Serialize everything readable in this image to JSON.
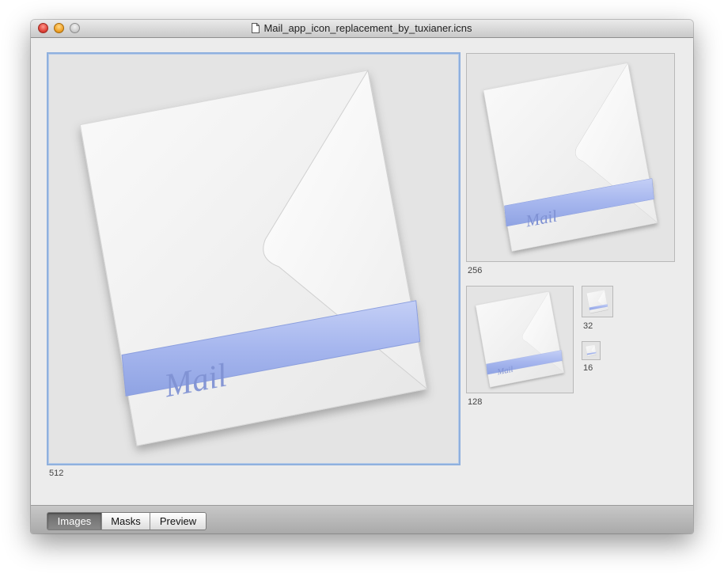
{
  "window": {
    "title": "Mail_app_icon_replacement_by_tuxianer.icns"
  },
  "icon": {
    "band_text": "Mail"
  },
  "sizes": [
    {
      "label": "512"
    },
    {
      "label": "256"
    },
    {
      "label": "128"
    },
    {
      "label": "32"
    },
    {
      "label": "16"
    }
  ],
  "tabs": [
    {
      "label": "Images",
      "selected": true
    },
    {
      "label": "Masks",
      "selected": false
    },
    {
      "label": "Preview",
      "selected": false
    }
  ],
  "colors": {
    "band": "#a8b8ee",
    "selection": "#8fb0de"
  }
}
